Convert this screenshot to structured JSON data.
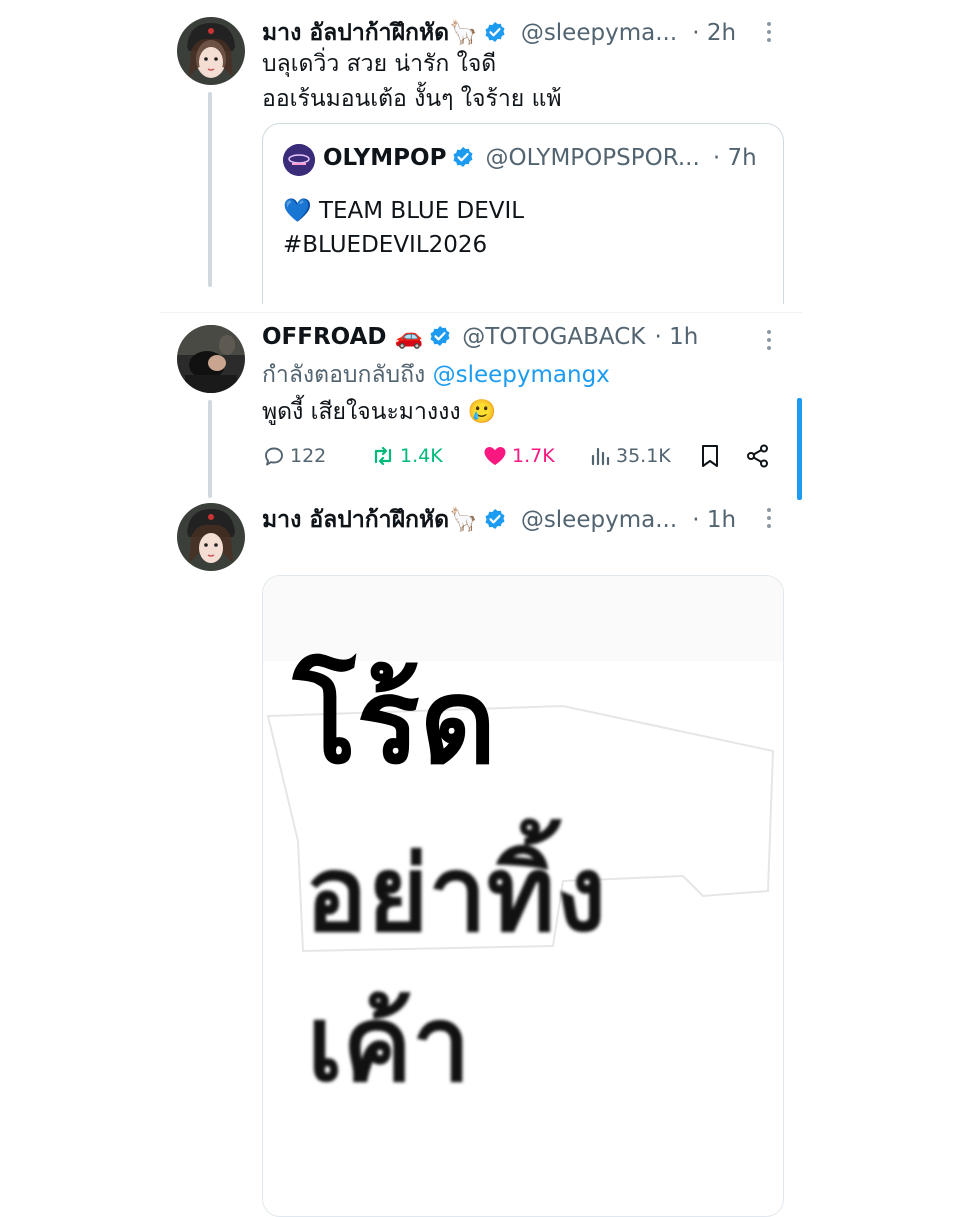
{
  "tweets": [
    {
      "name": "มาง อัลปาก้าฝึกหัด🦙",
      "handle": "@sleepyma...",
      "time": "· 2h",
      "lines": [
        "บลุเดวิ่ว สวย น่ารัก ใจดี",
        "ออเร้นมอนเต้อ งั้นๆ ใจร้าย แพ้"
      ],
      "quote": {
        "name": "OLYMPOP",
        "handle": "@OLYMPOPSPOR...",
        "time": "· 7h",
        "lines": [
          "💙 TEAM BLUE DEVIL",
          "#BLUEDEVIL2026"
        ]
      }
    },
    {
      "name": "OFFROAD 🚗",
      "handle": "@TOTOGABACK",
      "time": "· 1h",
      "reply_prefix": "กำลังตอบกลับถึง",
      "reply_to": "@sleepymangx",
      "text": "พูดงี้ เสียใจนะมางงง 🥲",
      "actions": {
        "replies": "122",
        "reposts": "1.4K",
        "likes": "1.7K",
        "views": "35.1K"
      }
    },
    {
      "name": "มาง อัลปาก้าฝึกหัด🦙",
      "handle": "@sleepyma...",
      "time": "· 1h",
      "image_text": [
        "โร้ด",
        "อย่าทิ้ง",
        "เค้า"
      ]
    }
  ],
  "colors": {
    "verified": "#1d9bf0",
    "link": "#1d9bf0",
    "repost": "#00ba7c",
    "like": "#f91880",
    "muted": "#536471"
  },
  "icons": [
    "verified-badge-icon",
    "more-icon",
    "reply-icon",
    "repost-icon",
    "like-icon",
    "views-icon",
    "bookmark-icon",
    "share-icon"
  ]
}
